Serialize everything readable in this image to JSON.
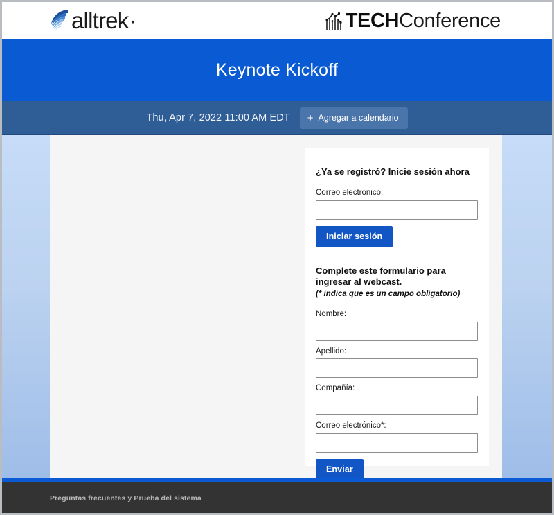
{
  "branding": {
    "left_logo_name": "alltrek",
    "left_logo_dot": "·",
    "right_logo_bold": "TECH",
    "right_logo_regular": "Conference"
  },
  "hero": {
    "title": "Keynote Kickoff"
  },
  "eventbar": {
    "datetime": "Thu, Apr 7, 2022 11:00 AM EDT",
    "add_calendar_label": "Agregar a calendario",
    "add_calendar_plus": "+"
  },
  "login": {
    "heading": "¿Ya se registró? Inicie sesión ahora",
    "email_label": "Correo electrónico:",
    "email_value": "",
    "email_placeholder": "",
    "submit_label": "Iniciar sesión"
  },
  "register": {
    "heading": "Complete este formulario para ingresar al webcast.",
    "required_note": "(* indica que es un campo obligatorio)",
    "fields": [
      {
        "label": "Nombre:",
        "value": "",
        "placeholder": ""
      },
      {
        "label": "Apellido:",
        "value": "",
        "placeholder": ""
      },
      {
        "label": "Compañía:",
        "value": "",
        "placeholder": ""
      },
      {
        "label": "Correo electrónico*:",
        "value": "",
        "placeholder": ""
      }
    ],
    "submit_label": "Enviar"
  },
  "footer": {
    "link_text": "Preguntas frecuentes y Prueba del sistema"
  },
  "colors": {
    "hero_blue": "#0a5ad4",
    "subbar_blue": "#2f5d96",
    "button_blue": "#1156c4",
    "footer_dark": "#333333",
    "stage_blue_top": "#c6dcf8",
    "stage_blue_bottom": "#9ebde8"
  }
}
